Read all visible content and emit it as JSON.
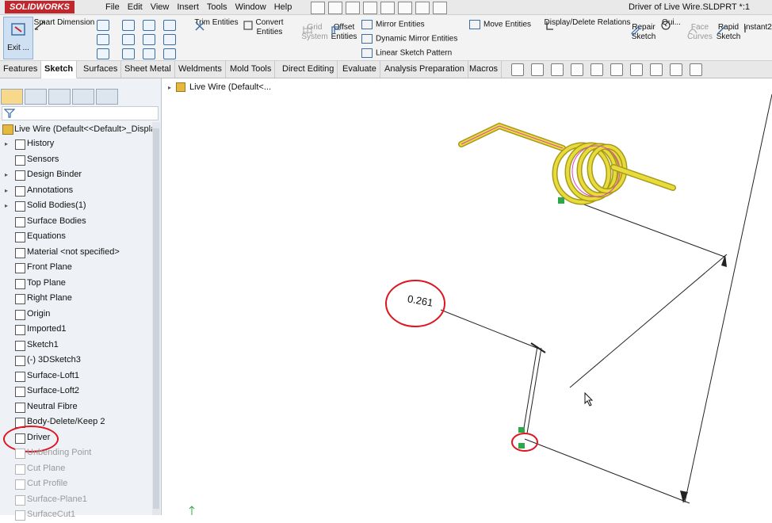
{
  "app": {
    "brand": "SOLIDWORKS",
    "document_title": "Driver of Live Wire.SLDPRT *:1"
  },
  "menus": [
    "File",
    "Edit",
    "View",
    "Insert",
    "Tools",
    "Window",
    "Help"
  ],
  "command_manager": {
    "exit_label": "Exit ...",
    "smart_dimension": "Smart Dimension",
    "trim_entities": "Trim Entities",
    "convert_entities": "Convert Entities",
    "grid_system_line1": "Grid",
    "grid_system_line2": "System",
    "offset_entities_line1": "Offset",
    "offset_entities_line2": "Entities",
    "mirror_entities": "Mirror Entities",
    "dynamic_mirror_entities": "Dynamic Mirror Entities",
    "linear_sketch_pattern": "Linear Sketch Pattern",
    "move_entities": "Move Entities",
    "display_delete_relations": "Display/Delete Relations",
    "repair_sketch_line1": "Repair",
    "repair_sketch_line2": "Sketch",
    "quick_snaps": "Qui...",
    "face_curves_line1": "Face",
    "face_curves_line2": "Curves",
    "rapid_sketch_line1": "Rapid",
    "rapid_sketch_line2": "Sketch",
    "instant2d": "Instant2"
  },
  "tabs": [
    "Features",
    "Sketch",
    "Surfaces",
    "Sheet Metal",
    "Weldments",
    "Mold Tools",
    "Direct Editing",
    "Evaluate",
    "Analysis Preparation",
    "Macros"
  ],
  "active_tab": "Sketch",
  "feature_tree": {
    "root": "Live Wire  (Default<<Default>_Displa",
    "items": [
      {
        "label": "History",
        "expandable": true,
        "disabled": false
      },
      {
        "label": "Sensors",
        "expandable": false,
        "disabled": false
      },
      {
        "label": "Design Binder",
        "expandable": true,
        "disabled": false
      },
      {
        "label": "Annotations",
        "expandable": true,
        "disabled": false
      },
      {
        "label": "Solid Bodies(1)",
        "expandable": true,
        "disabled": false
      },
      {
        "label": "Surface Bodies",
        "expandable": false,
        "disabled": false
      },
      {
        "label": "Equations",
        "expandable": false,
        "disabled": false
      },
      {
        "label": "Material <not specified>",
        "expandable": false,
        "disabled": false
      },
      {
        "label": "Front Plane",
        "expandable": false,
        "disabled": false
      },
      {
        "label": "Top Plane",
        "expandable": false,
        "disabled": false
      },
      {
        "label": "Right Plane",
        "expandable": false,
        "disabled": false
      },
      {
        "label": "Origin",
        "expandable": false,
        "disabled": false
      },
      {
        "label": "Imported1",
        "expandable": false,
        "disabled": false
      },
      {
        "label": "Sketch1",
        "expandable": false,
        "disabled": false
      },
      {
        "label": "(-) 3DSketch3",
        "expandable": false,
        "disabled": false
      },
      {
        "label": "Surface-Loft1",
        "expandable": false,
        "disabled": false
      },
      {
        "label": "Surface-Loft2",
        "expandable": false,
        "disabled": false
      },
      {
        "label": "Neutral Fibre",
        "expandable": false,
        "disabled": false
      },
      {
        "label": "Body-Delete/Keep 2",
        "expandable": false,
        "disabled": false
      },
      {
        "label": "Driver",
        "expandable": false,
        "disabled": false
      },
      {
        "label": "Unbending Point",
        "expandable": false,
        "disabled": true
      },
      {
        "label": "Cut Plane",
        "expandable": false,
        "disabled": true
      },
      {
        "label": "Cut Profile",
        "expandable": false,
        "disabled": true
      },
      {
        "label": "Surface-Plane1",
        "expandable": false,
        "disabled": true
      },
      {
        "label": "SurfaceCut1",
        "expandable": false,
        "disabled": true
      }
    ]
  },
  "viewport": {
    "breadcrumb": "Live Wire  (Default<...",
    "dimension_value": "0.261"
  },
  "colors": {
    "accent_red": "#e0141e",
    "brand_red": "#c0272d",
    "spring_yellow": "#e8dc3c",
    "spring_pink": "#e040c8"
  }
}
